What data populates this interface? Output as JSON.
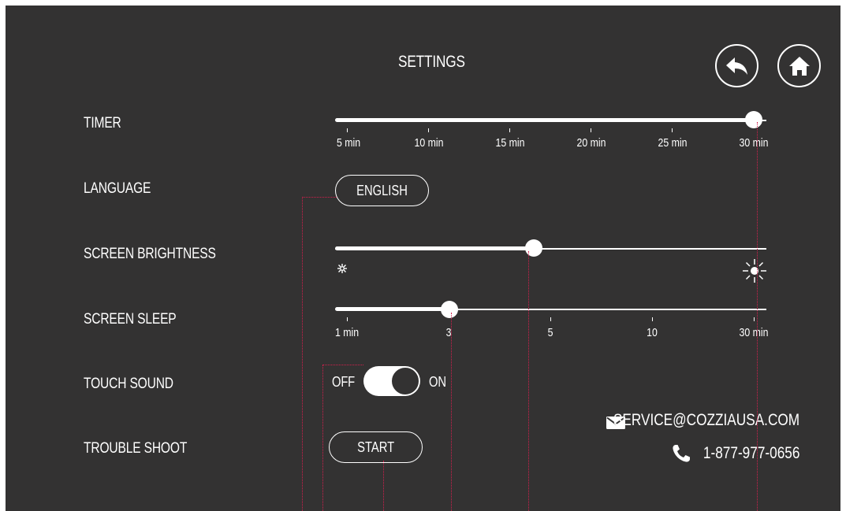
{
  "header": {
    "title": "SETTINGS",
    "back_icon": "back-arrow-icon",
    "home_icon": "home-icon"
  },
  "timer": {
    "label": "TIMER",
    "ticks": [
      "5 min",
      "10 min",
      "15 min",
      "20 min",
      "25 min",
      "30 min"
    ],
    "value": "30 min"
  },
  "language": {
    "label": "LANGUAGE",
    "value": "ENGLISH"
  },
  "brightness": {
    "label": "SCREEN BRIGHTNESS",
    "level": 0.46,
    "low_icon": "dim-sun-icon",
    "high_icon": "bright-sun-icon"
  },
  "sleep": {
    "label": "SCREEN SLEEP",
    "ticks": [
      "1 min",
      "3",
      "5",
      "10",
      "30 min"
    ],
    "value": "3"
  },
  "touch_sound": {
    "label": "TOUCH SOUND",
    "off_label": "OFF",
    "on_label": "ON",
    "state": "on"
  },
  "trouble_shoot": {
    "label": "TROUBLE SHOOT",
    "button": "START"
  },
  "contact": {
    "email": "SERVICE@COZZIAUSA.COM",
    "phone": "1-877-977-0656",
    "email_icon": "envelope-icon",
    "phone_icon": "phone-icon"
  },
  "colors": {
    "background": "#333232",
    "foreground": "#ffffff",
    "guide_lines": "#d21f4d"
  }
}
